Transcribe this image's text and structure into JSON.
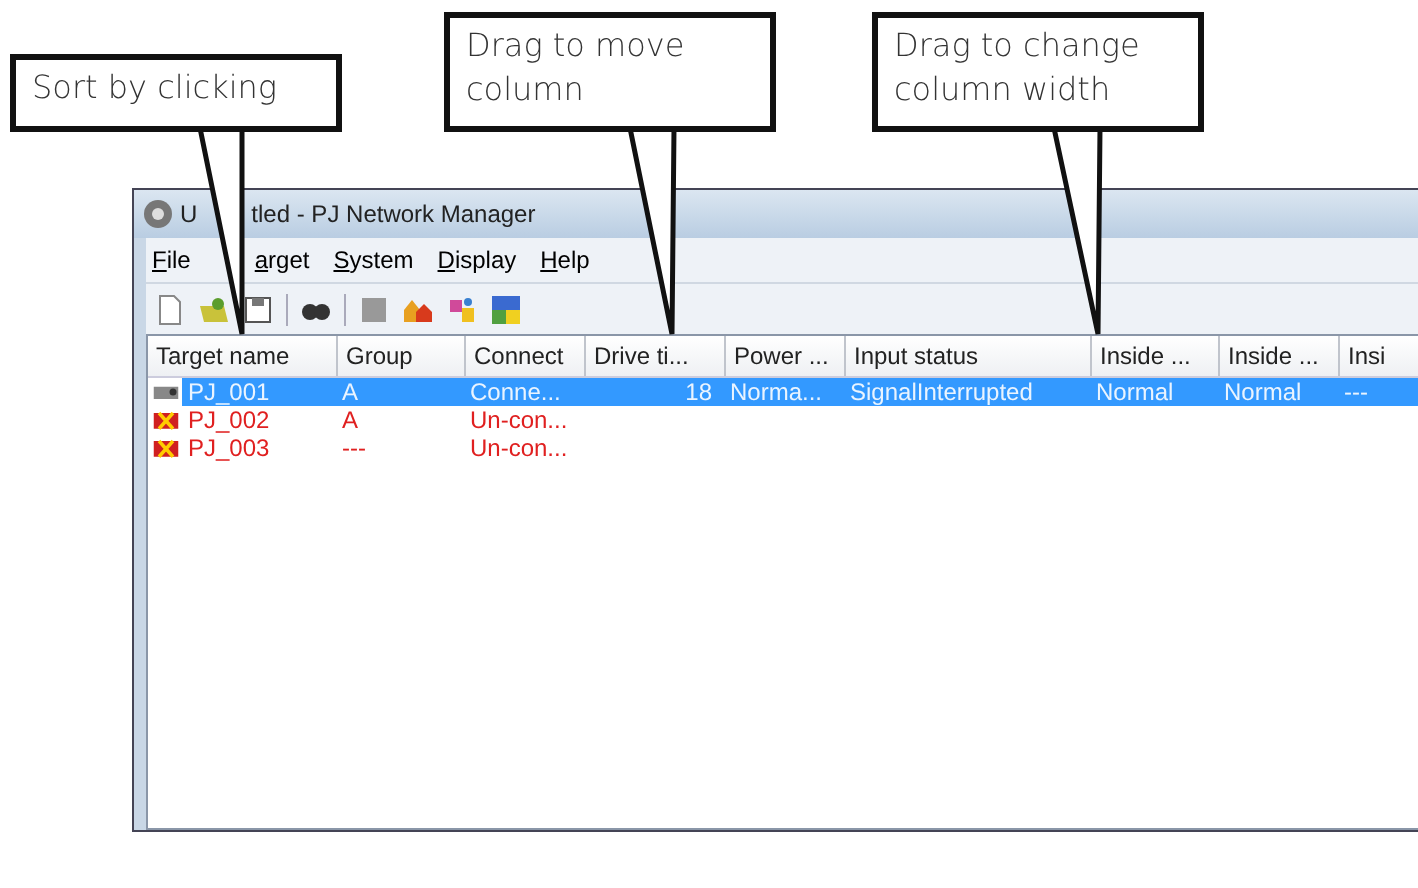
{
  "callouts": [
    {
      "text": "Sort by clicking"
    },
    {
      "text": "Drag to move column"
    },
    {
      "text": "Drag to change column width"
    }
  ],
  "window": {
    "title": [
      "U",
      "tled - PJ Network Manager"
    ],
    "menu": [
      "File",
      "arget",
      "System",
      "Display",
      "Help"
    ],
    "table": {
      "columns": [
        "Target name",
        "Group",
        "Connect",
        "Drive ti...",
        "Power ...",
        "Input status",
        "Inside ...",
        "Inside ...",
        "Insi"
      ],
      "rows": [
        {
          "selected": true,
          "connected": true,
          "cells": [
            "PJ_001",
            "A",
            "Conne...",
            "18",
            "Norma...",
            "SignalInterrupted",
            "Normal",
            "Normal",
            "---"
          ]
        },
        {
          "selected": false,
          "connected": false,
          "cells": [
            "PJ_002",
            "A",
            "Un-con..."
          ]
        },
        {
          "selected": false,
          "connected": false,
          "cells": [
            "PJ_003",
            "---",
            "Un-con..."
          ]
        }
      ]
    }
  }
}
